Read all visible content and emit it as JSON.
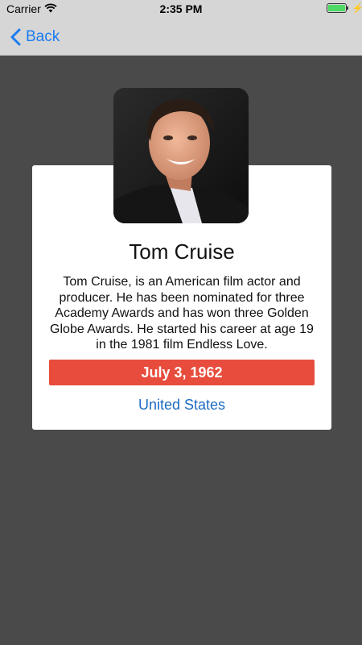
{
  "status_bar": {
    "carrier": "Carrier",
    "time": "2:35 PM",
    "battery_level": 1.0,
    "battery_color": "#4cd964"
  },
  "nav": {
    "back_label": "Back",
    "tint_color": "#1a7cf0"
  },
  "profile": {
    "name": "Tom Cruise",
    "bio": "Tom Cruise, is an American film actor and producer. He has been nominated for three Academy Awards and has won three Golden Globe Awards. He started his career at age 19 in the 1981 film Endless Love.",
    "birth_date": "July 3, 1962",
    "country": "United States"
  },
  "colors": {
    "background": "#4a4a4a",
    "card": "#ffffff",
    "date_badge": "#e74c3c",
    "link": "#1e6bc4"
  }
}
